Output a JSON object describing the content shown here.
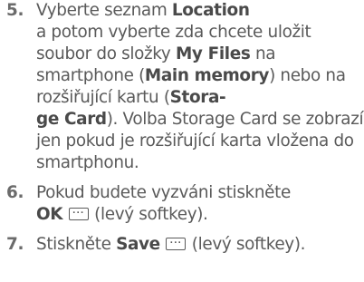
{
  "steps": [
    {
      "number": "5.",
      "t1": "Vyberte seznam ",
      "b1": "Location",
      "t2": " a potom vyberte zda chcete uložit soubor do složky ",
      "b2": "My Files",
      "t3": " na smartphone (",
      "b3": "Main memory",
      "t4": ") nebo na rozšiřující kartu (",
      "b4a": "Stora-",
      "b4b": "ge Card",
      "t5": "). Volba Storage Card se zobrazí jen  pokud je rozšiřující karta vložena do smartphonu."
    },
    {
      "number": "6.",
      "t1": "Pokud budete vyzváni stiskněte ",
      "b1": "OK",
      "t2": " (levý softkey).",
      "key_icon": "softkey-icon"
    },
    {
      "number": "7.",
      "t1": "Stiskněte ",
      "b1": "Save",
      "t2": " (levý softkey).",
      "key_icon": "softkey-icon"
    }
  ],
  "colors": {
    "text": "#5a5a5a",
    "bold": "#4a4a4a"
  }
}
